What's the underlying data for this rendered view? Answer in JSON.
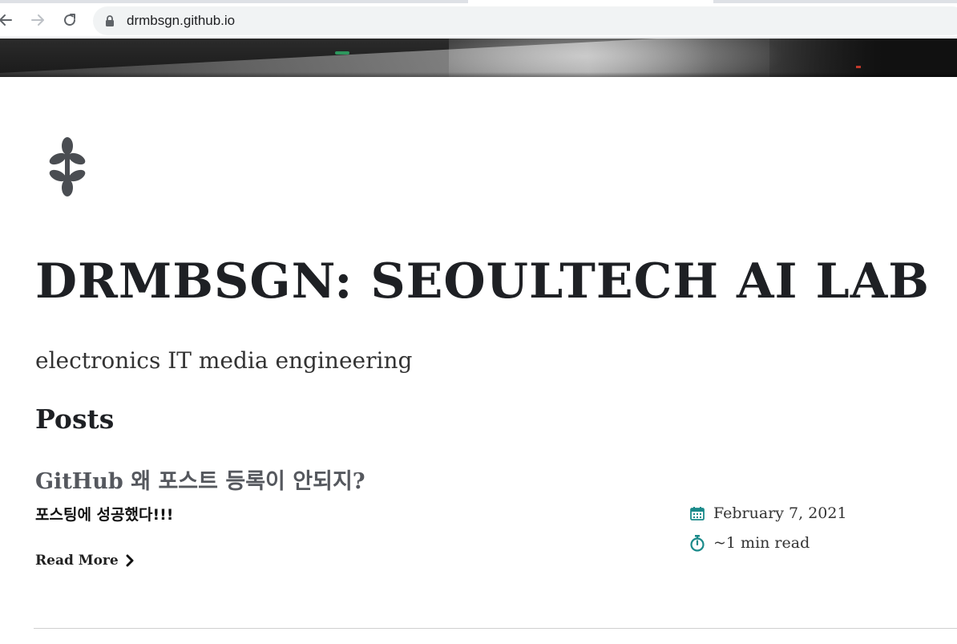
{
  "browser": {
    "url": "drmbsgn.github.io"
  },
  "site": {
    "title": "DRMBSGN: SEOULTECH AI LAB",
    "subtitle": "electronics IT media engineering",
    "posts_heading": "Posts"
  },
  "post": {
    "title": "GitHub 왜 포스트 등록이 안되지?",
    "excerpt": "포스팅에 성공했다!!!",
    "read_more": "Read More",
    "date": "February 7, 2021",
    "read_time": "~1 min read"
  },
  "colors": {
    "accent_teal": "#1a8a8a",
    "title": "#1e2024",
    "post_title": "#55585e"
  },
  "icons": {
    "back": "arrow-left-icon",
    "forward": "arrow-right-icon",
    "reload": "reload-icon",
    "lock": "lock-icon",
    "logo": "quatrefoil-logo-icon",
    "calendar": "calendar-icon",
    "stopwatch": "stopwatch-icon",
    "chevron": "chevron-right-icon"
  }
}
